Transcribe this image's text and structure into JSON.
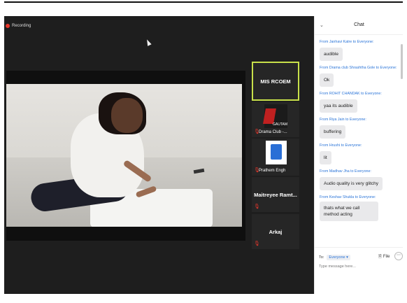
{
  "meeting": {
    "recording_label": "Recording",
    "tiles": [
      {
        "name": "MIS RCOEM"
      },
      {
        "caption": "Drama Club -...",
        "logo_text": "GAUTAM"
      },
      {
        "caption": "Prathem Engh"
      },
      {
        "name": "Maitreyee  Ramt..."
      },
      {
        "name": "Arkaj"
      }
    ]
  },
  "chat": {
    "title": "Chat",
    "messages": [
      {
        "from": "From Janhavi Katre to Everyone:",
        "text": "audible"
      },
      {
        "from": "From Drama club Shrashtha Gole to Everyone:",
        "text": "Ok"
      },
      {
        "from": "From ROHIT CHANDAK to Everyone:",
        "text": "yaa its audible"
      },
      {
        "from": "From Riya Jain to Everyone:",
        "text": "buffering"
      },
      {
        "from": "From Hrushi to Everyone:",
        "text": "lit"
      },
      {
        "from": "From Madhav Jha to Everyone:",
        "text": "Audio quality is very glitchy"
      },
      {
        "from": "From Keshav Shukla to Everyone:",
        "text": "thats what we call method acting"
      }
    ],
    "to_label": "To:",
    "to_value": "Everyone",
    "file_label": "File",
    "input_placeholder": "Type message here..."
  },
  "colors": {
    "recording": "#e8372c",
    "active_speaker": "#c8e04a",
    "chat_sender": "#2a74d8"
  }
}
